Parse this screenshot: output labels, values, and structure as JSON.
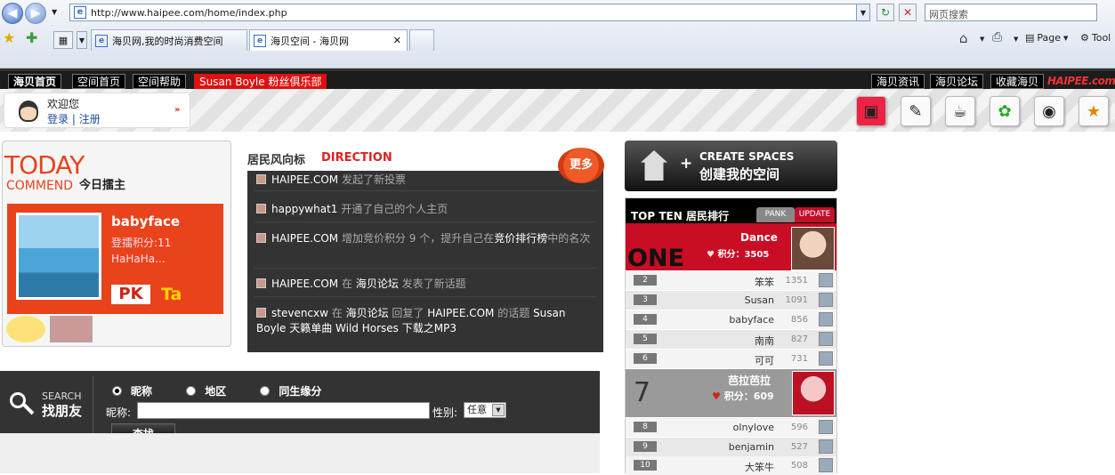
{
  "browser": {
    "address": "http://www.haipee.com/home/index.php",
    "search_placeholder": "网页搜索",
    "tabs": [
      {
        "label": "海贝网,我的时尚消费空间"
      },
      {
        "label": "海贝空间 - 海贝网"
      }
    ],
    "cmd_page": "Page",
    "cmd_tools": "Tool"
  },
  "site_nav": {
    "left": [
      "海贝首页",
      "空间首页",
      "空间帮助",
      "Susan Boyle 粉丝俱乐部"
    ],
    "right": [
      "海贝资讯",
      "海贝论坛",
      "收藏海贝"
    ],
    "logo": "HAIPEE.com"
  },
  "welcome": {
    "greeting": "欢迎您",
    "login": "登录",
    "sep": "|",
    "register": "注册"
  },
  "today": {
    "big": "TODAY",
    "commend": "COMMEND",
    "subtitle": "今日擂主",
    "name": "babyface",
    "score": "登擂积分:11",
    "motto": "HaHaHa...",
    "pk": "PK",
    "ta": "Ta"
  },
  "direction": {
    "title_cn": "居民风向标",
    "title_en": "DIRECTION",
    "more": "更多",
    "items": [
      {
        "user": "HAIPEE.COM",
        "text": " 发起了新投票"
      },
      {
        "user": "happywhat1",
        "text": " 开通了自己的个人主页"
      },
      {
        "user": "HAIPEE.COM",
        "text": " 增加竞价积分 9 个，提升自己在",
        "link": "竞价排行榜",
        "tail": "中的名次"
      },
      {
        "user": "HAIPEE.COM",
        "text": " 在 ",
        "link": "海贝论坛",
        "tail": " 发表了新话题"
      },
      {
        "user": "stevencxw",
        "text": " 在 ",
        "link": "海贝论坛",
        "tail": " 回复了 ",
        "link2": "HAIPEE.COM",
        "tail2": " 的话题 ",
        "link3": "Susan Boyle 天籁单曲 Wild Horses 下载之MP3"
      }
    ]
  },
  "create": {
    "en": "CREATE SPACES",
    "cn": "创建我的空间"
  },
  "topten": {
    "title": "TOP TEN 居民排行",
    "tab_rank": "PANK",
    "tab_update": "UPDATE",
    "first": {
      "label": "ONE",
      "name": "Dance",
      "score_label": "积分：3505"
    },
    "seventh": {
      "num": "7",
      "name": "芭拉芭拉",
      "score_label": "积分：609"
    },
    "rows": [
      {
        "num": "2",
        "name": "笨笨",
        "score": "1351"
      },
      {
        "num": "3",
        "name": "Susan",
        "score": "1091"
      },
      {
        "num": "4",
        "name": "babyface",
        "score": "856"
      },
      {
        "num": "5",
        "name": "南南",
        "score": "827"
      },
      {
        "num": "6",
        "name": "可可",
        "score": "731"
      },
      {
        "num": "8",
        "name": "olnylove",
        "score": "596"
      },
      {
        "num": "9",
        "name": "benjamin",
        "score": "527"
      },
      {
        "num": "10",
        "name": "大笨牛",
        "score": "508"
      }
    ]
  },
  "search": {
    "en": "SEARCH",
    "cn": "找朋友",
    "options": [
      "昵称",
      "地区",
      "同生缘分"
    ],
    "nick_label": "昵称:",
    "gender_label": "性别:",
    "gender_value": "任意",
    "button": "查找"
  }
}
